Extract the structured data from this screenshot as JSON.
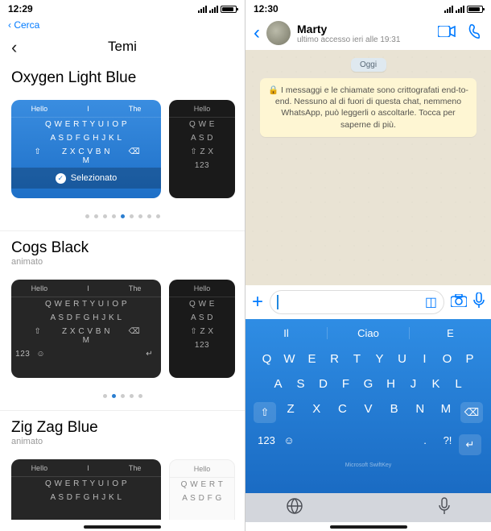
{
  "left": {
    "status_time": "12:29",
    "back_label": "Cerca",
    "title": "Temi",
    "themes": [
      {
        "name_strong": "Oxygen",
        "name_rest": " Light Blue",
        "subtitle": "",
        "selected_label": "Selezionato",
        "dot_count": 9,
        "dot_active": 4
      },
      {
        "name_strong": "Cogs",
        "name_rest": " Black",
        "subtitle": "animato",
        "dot_count": 5,
        "dot_active": 1
      },
      {
        "name_strong": "Zig Zag",
        "name_rest": " Blue",
        "subtitle": "animato"
      }
    ],
    "suggestions": [
      "Hello",
      "I",
      "The"
    ],
    "rows": {
      "r1": "Q W E R T Y U I O P",
      "r2": "A S D F G H J K L",
      "r3_left": "⇧",
      "r3_mid": "Z X C V B N M",
      "r3_right": "⌫",
      "r4_left": "123",
      "r4_face": "☺"
    }
  },
  "right": {
    "status_time": "12:30",
    "name": "Marty",
    "last_access": "ultimo accesso ieri alle 19:31",
    "today": "Oggi",
    "encryption": "🔒 I messaggi e le chiamate sono crittografati end-to-end. Nessuno al di fuori di questa chat, nemmeno WhatsApp, può leggerli o ascoltarle. Tocca per saperne di più.",
    "suggestions": [
      "Il",
      "Ciao",
      "E"
    ],
    "rows": {
      "r1": "Q W E R T Y U I O P",
      "r2": "A S D F G H J K L",
      "r3_mid": "Z X C V B N M",
      "r4_123": "123",
      "r4_face": "☺",
      "r4_period": ".",
      "r4_exc": "?!"
    },
    "microsoft": "Microsoft SwiftKey"
  }
}
